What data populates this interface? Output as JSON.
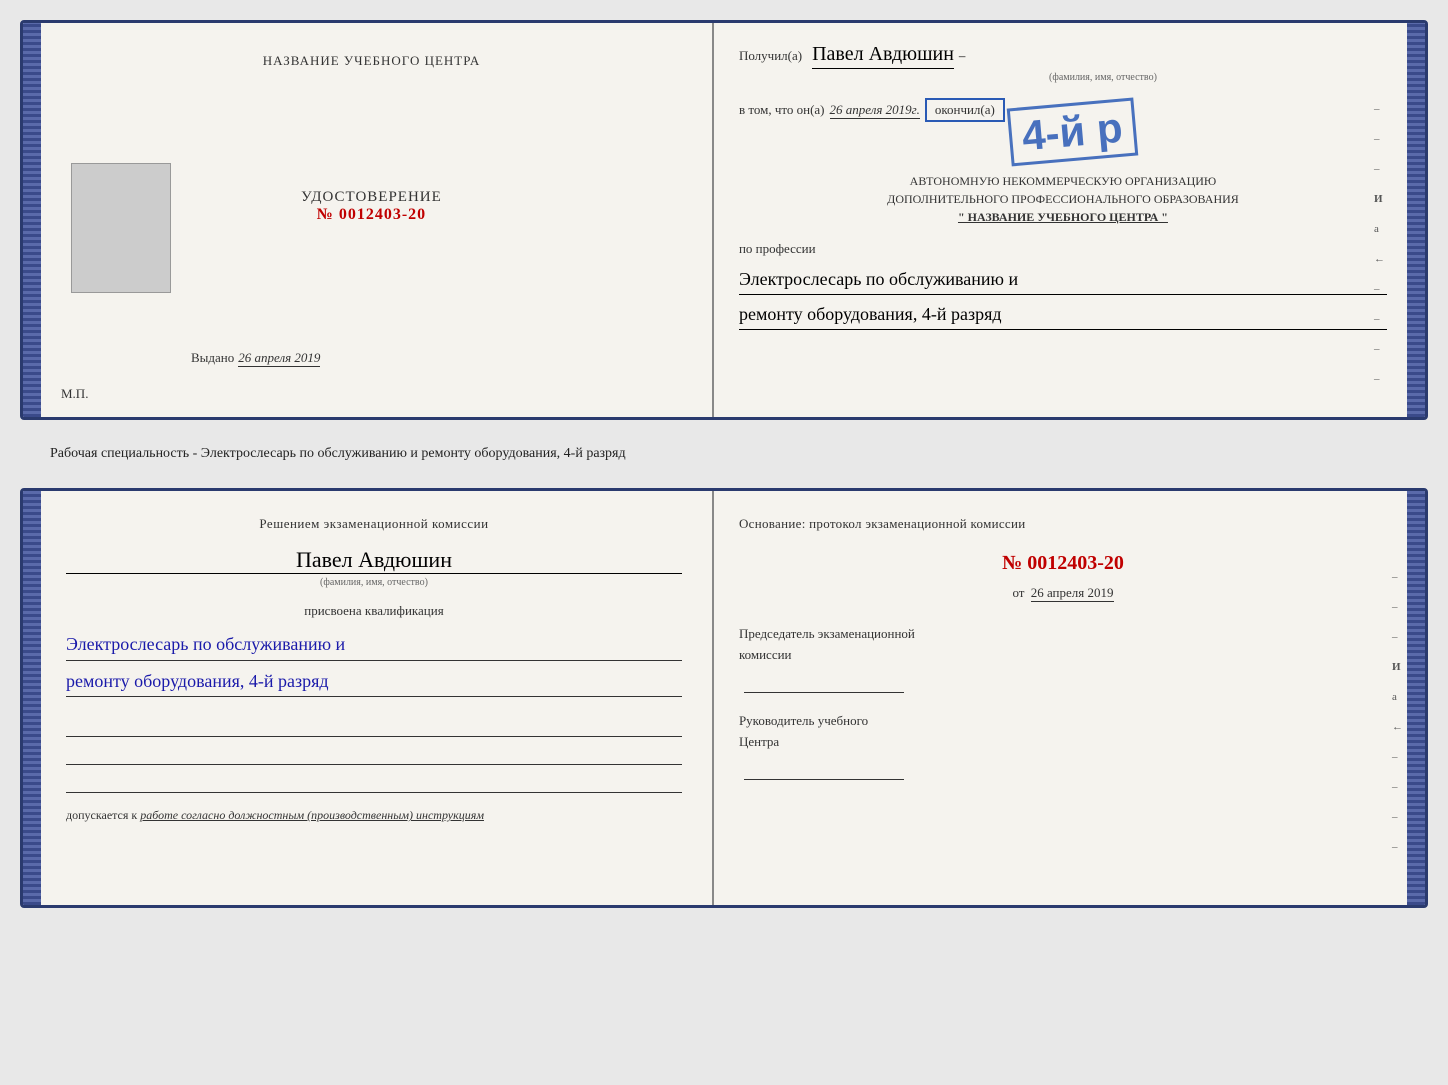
{
  "topDoc": {
    "left": {
      "centerTitle": "НАЗВАНИЕ УЧЕБНОГО ЦЕНТРА",
      "udostoverenie": "УДОСТОВЕРЕНИЕ",
      "number": "№ 0012403-20",
      "vydanoLabel": "Выдано",
      "vydanoDate": "26 апреля 2019",
      "mpLabel": "М.П."
    },
    "right": {
      "receivedLabel": "Получил(a)",
      "receivedName": "Павел Авдюшин",
      "fioHint": "(фамилия, имя, отчество)",
      "vtomLabel": "в том, что он(а)",
      "dateHandwritten": "26 апреля 2019г.",
      "okonchilLabel": "окончил(а)",
      "razryadStamp": "4-й р",
      "orgLine1": "АВТОНОМНУЮ НЕКОММЕРЧЕСКУЮ ОРГАНИЗАЦИЮ",
      "orgLine2": "ДОПОЛНИТЕЛЬНОГО ПРОФЕССИОНАЛЬНОГО ОБРАЗОВАНИЯ",
      "orgName": "\" НАЗВАНИЕ УЧЕБНОГО ЦЕНТРА \"",
      "poProfessii": "по профессии",
      "profession1": "Электрослесарь по обслуживанию и",
      "profession2": "ремонту оборудования, 4-й разряд"
    }
  },
  "middleText": "Рабочая специальность - Электрослесарь по обслуживанию и ремонту оборудования, 4-й разряд",
  "bottomDoc": {
    "left": {
      "decisionTitle": "Решением экзаменационной комиссии",
      "personName": "Павел Авдюшин",
      "fioHint": "(фамилия, имя, отчество)",
      "prisvoena": "присвоена квалификация",
      "qual1": "Электрослесарь по обслуживанию и",
      "qual2": "ремонту оборудования, 4-й разряд",
      "dopuskaetsya": "допускается к",
      "dopuskText": "работе согласно должностным (производственным) инструкциям"
    },
    "right": {
      "osnovanie": "Основание: протокол экзаменационной комиссии",
      "protocolNumber": "№ 0012403-20",
      "otLabel": "от",
      "otDate": "26 апреля 2019",
      "predsedatel1": "Председатель экзаменационной",
      "predsedatel2": "комиссии",
      "rukovoditel1": "Руководитель учебного",
      "rukovoditel2": "Центра"
    }
  },
  "sideTexts": {
    "И": "И",
    "а": "а",
    "leftArrow": "←"
  }
}
